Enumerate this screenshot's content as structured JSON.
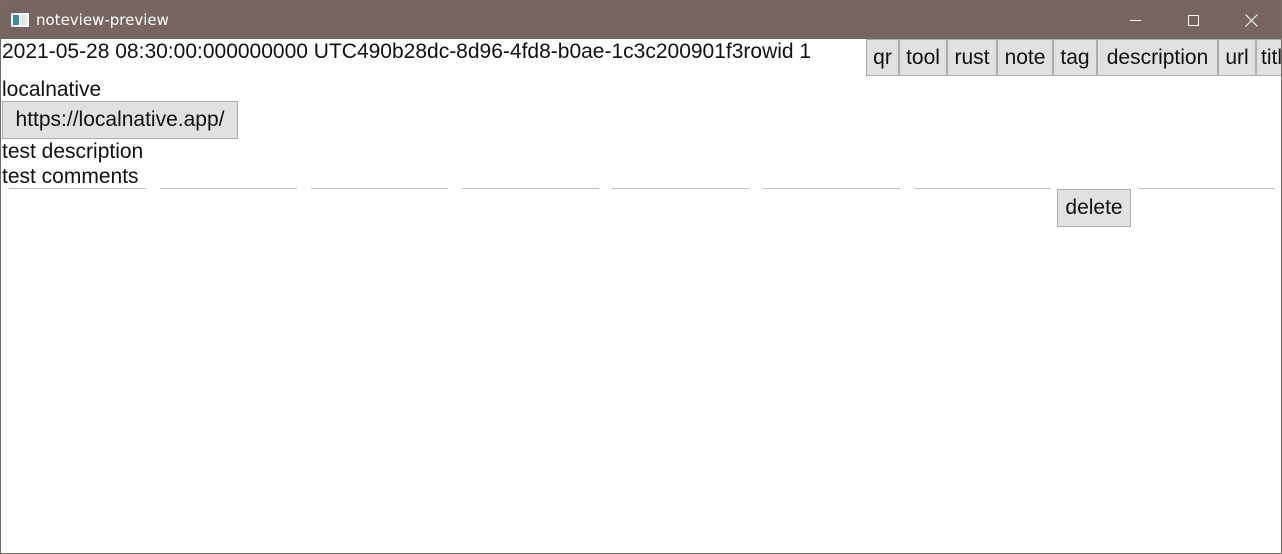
{
  "window": {
    "title": "noteview-preview",
    "controls": {
      "minimize_icon": "minimize-icon",
      "maximize_icon": "maximize-icon",
      "close_icon": "close-icon"
    }
  },
  "note": {
    "meta_line": "2021-05-28 08:30:00:000000000 UTC490b28dc-8d96-4fd8-b0ae-1c3c200901f3rowid 1",
    "tags": [
      "qr",
      "tool",
      "rust",
      "note",
      "tag",
      "description",
      "url",
      "title"
    ],
    "site_name": "localnative",
    "url": "https://localnative.app/",
    "description": "test description",
    "comments": "test comments",
    "delete_label": "delete"
  },
  "colors": {
    "titlebar_bg": "#776561",
    "button_bg": "#e1e1e1",
    "button_border": "#adadad"
  }
}
